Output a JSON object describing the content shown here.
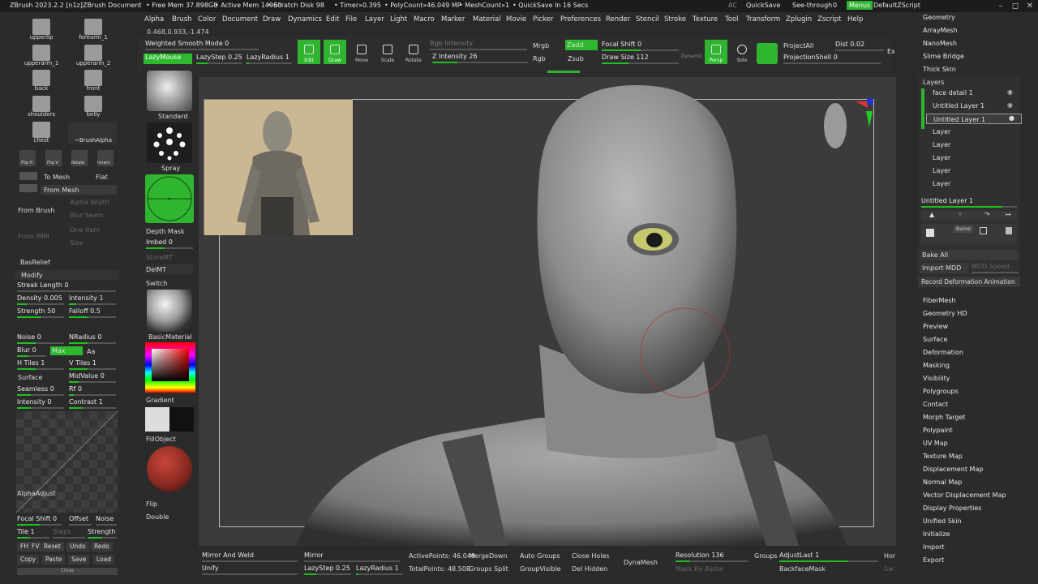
{
  "titlebar": {
    "app": "ZBrush 2023.2.2 [n1z]",
    "document": "ZBrush Document",
    "free_mem": "• Free Mem 37.898GB",
    "active_mem": "• Active Mem 14960",
    "scratch": "• Scratch Disk 98",
    "timer": "• Timer»0.395",
    "polycount": "• PolyCount»46.049 MP",
    "meshcount": "• MeshCount»1",
    "quicksave_in": "• QuickSave In 16 Secs",
    "ac": "AC",
    "quicksave": "QuickSave",
    "see_through": "See-through",
    "see_through_val": "0",
    "menus": "Menus",
    "script": "DefaultZScript"
  },
  "menu": [
    "Alpha",
    "Brush",
    "Color",
    "Document",
    "Draw",
    "Dynamics",
    "Edit",
    "File",
    "Layer",
    "Light",
    "Macro",
    "Marker",
    "Material",
    "Movie",
    "Picker",
    "Preferences",
    "Render",
    "Stencil",
    "Stroke",
    "Texture",
    "Tool",
    "Transform",
    "Zplugin",
    "Zscript",
    "Help"
  ],
  "coords": "0.468,0.933,-1.474",
  "toolbar": {
    "weighted_smooth": "Weighted Smooth Mode 0",
    "lazymouse": "LazyMouse",
    "lazystep": "LazyStep 0.25",
    "lazyradius": "LazyRadius 1",
    "edit": "Edit",
    "draw": "Draw",
    "move": "Move",
    "scale": "Scale",
    "rotate": "Rotate",
    "rgb_intensity": "Rgb Intensity",
    "z_intensity": "Z Intensity 26",
    "mrgb": "Mrgb",
    "rgb": "Rgb",
    "zadd": "Zadd",
    "zsub": "Zsub",
    "focal_shift": "Focal Shift 0",
    "draw_size": "Draw Size 112",
    "dynamic": "Dynamic",
    "persp": "Persp",
    "solo": "Solo",
    "project_all": "ProjectAll",
    "dist": "Dist 0.02",
    "projection_shell": "ProjectionShell 0",
    "ex": "Ex"
  },
  "left": {
    "alphas": [
      "upperlip",
      "forearm_1",
      "upperarm_1",
      "upperarm_2",
      "back",
      "front",
      "shoulders",
      "belly",
      "chest",
      "~BrushAlpha"
    ],
    "flip_h": "Flip H",
    "flip_v": "Flip V",
    "rotate": "Rotate",
    "invers": "Invers",
    "to_mesh": "To Mesh",
    "flat": "Flat",
    "from_mesh": "From Mesh",
    "alpha_width": "Alpha Width",
    "from_brush": "From Brush",
    "blur_seam": "Blur Seam",
    "one_item": "One Item",
    "from_imm": "From IMM",
    "size": "Size",
    "basrelief": "BasRelief",
    "modify": "Modify",
    "streak": "Streak Length 0",
    "density": "Density 0.005",
    "intensity": "Intensity 1",
    "strength": "Strength 50",
    "falloff": "Falloff 0.5",
    "noise": "Noise 0",
    "nradius": "NRadius 0",
    "blur": "Blur 0",
    "max": "Max",
    "aa": "Aa",
    "htiles": "H Tiles 1",
    "vtiles": "V Tiles 1",
    "surface": "Surface",
    "midvalue": "MidValue 0",
    "seamless": "Seamless 0",
    "rf": "Rf 0",
    "intensity0": "Intensity 0",
    "contrast": "Contrast 1",
    "alpha_adjust": "AlphaAdjust",
    "focal_shift0": "Focal Shift 0",
    "offset": "Offset",
    "noise2": "Noise",
    "tile": "Tile 1",
    "steps": "Steps",
    "strength2": "Strength",
    "fh": "FH",
    "fv": "FV",
    "reset": "Reset",
    "undo": "Undo",
    "redo": "Redo",
    "copy": "Copy",
    "paste": "Paste",
    "save": "Save",
    "load": "Load",
    "close": "Close"
  },
  "mid": {
    "standard": "Standard",
    "spray": "Spray",
    "depth_mask": "Depth Mask",
    "imbed": "Imbed 0",
    "store_mt": "StoreMT",
    "del_mt": "DelMT",
    "switch": "Switch",
    "basic_material": "BasicMaterial",
    "gradient": "Gradient",
    "fill_object": "FillObject",
    "flip": "Flip",
    "double": "Double"
  },
  "right": {
    "top_items": [
      "Geometry",
      "ArrayMesh",
      "NanoMesh",
      "Slime Bridge",
      "Thick Skin"
    ],
    "layers_title": "Layers",
    "layers": [
      "face detail 1",
      "Untitled Layer 1",
      "Untitled Layer 1"
    ],
    "empty_layers": [
      "Layer",
      "Layer",
      "Layer",
      "Layer",
      "Layer"
    ],
    "selected_layer": "Untitled Layer 1",
    "name": "Name",
    "bake_all": "Bake All",
    "import_mdd": "Import MDD",
    "mdd_speed": "MDD Speed",
    "record_anim": "Record Deformation Animation",
    "menu_items": [
      "FiberMesh",
      "Geometry HD",
      "Preview",
      "Surface",
      "Deformation",
      "Masking",
      "Visibility",
      "Polygroups",
      "Contact",
      "Morph Target",
      "Polypaint",
      "UV Map",
      "Texture Map",
      "Displacement Map",
      "Normal Map",
      "Vector Displacement Map",
      "Display Properties",
      "Unified Skin",
      "Initialize",
      "Import",
      "Export"
    ]
  },
  "bottom": {
    "mirror_weld": "Mirror And Weld",
    "unify": "Unify",
    "mirror": "Mirror",
    "lazystep": "LazyStep 0.25",
    "lazyradius": "LazyRadius 1",
    "active_points": "ActivePoints: 46.049",
    "total_points": "TotalPoints: 48.508",
    "merge_down": "MergeDown",
    "groups_split": "Groups Split",
    "auto_groups": "Auto Groups",
    "group_visible": "GroupVisible",
    "close_holes": "Close Holes",
    "del_hidden": "Del Hidden",
    "dynamesh": "DynaMesh",
    "resolution": "Resolution 136",
    "mask_by_alpha": "Mask By Alpha",
    "groups": "Groups",
    "adjust_last": "AdjustLast 1",
    "backface_mask": "BackfaceMask",
    "hor": "Hor",
    "sw": "Sw"
  },
  "colors": {
    "accent": "#2fb52f",
    "background": "#2a2a2a",
    "viewport": "#3b3b3b"
  }
}
